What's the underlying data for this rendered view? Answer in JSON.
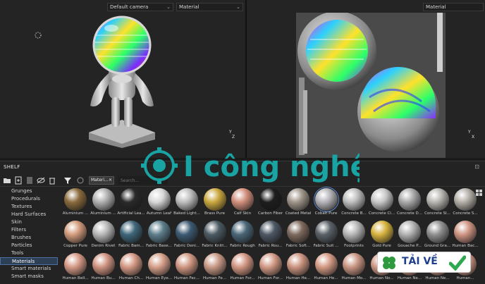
{
  "viewport3d": {
    "camera_dropdown": "Default camera",
    "channel_dropdown": "Material",
    "axis_y": "Y",
    "axis_z": "Z",
    "axis_x": "X"
  },
  "viewport2d": {
    "channel_dropdown": "Material",
    "axis_y": "Y",
    "axis_x": "X"
  },
  "shelf": {
    "title": "SHELF",
    "filter_chip": "Materi...",
    "search_placeholder": "Search...",
    "categories": [
      "Grunges",
      "Procedurals",
      "Textures",
      "Hard Surfaces",
      "Skin",
      "Filters",
      "Brushes",
      "Particles",
      "Tools",
      "Materials",
      "Smart materials",
      "Smart masks"
    ],
    "selected_category": "Materials",
    "materials": [
      {
        "label": "Aluminium ...",
        "color": "#8a6a3c"
      },
      {
        "label": "Aluminium ...",
        "color": "#b0b0b0"
      },
      {
        "label": "Artificial Lea...",
        "color": "#2a2a2a"
      },
      {
        "label": "Autumn Leaf",
        "color": "#d7d7d7"
      },
      {
        "label": "Baked Light...",
        "color": "#bdbdbd"
      },
      {
        "label": "Brass Pure",
        "color": "#caa73e"
      },
      {
        "label": "Calf Skin",
        "color": "#d28f7c"
      },
      {
        "label": "Carbon Fiber",
        "color": "#1d1d1d"
      },
      {
        "label": "Coated Metal",
        "color": "#9e9489"
      },
      {
        "label": "Cobalt Pure",
        "color": "#b3b3b8"
      },
      {
        "label": "Concrete B...",
        "color": "#bdbdbd"
      },
      {
        "label": "Concrete Cl...",
        "color": "#c7c7c7"
      },
      {
        "label": "Concrete D...",
        "color": "#a9a9a9"
      },
      {
        "label": "Concrete Sl...",
        "color": "#b7b5b0"
      },
      {
        "label": "Concrete S...",
        "color": "#b3aea7"
      },
      {
        "label": "Copper Pure",
        "color": "#d29b7c"
      },
      {
        "label": "Denim Rivet",
        "color": "#b7b7b7"
      },
      {
        "label": "Fabric Bam...",
        "color": "#3f6679"
      },
      {
        "label": "Fabric Base...",
        "color": "#5d7d8c"
      },
      {
        "label": "Fabric Deni...",
        "color": "#3c5a72"
      },
      {
        "label": "Fabric Knitt...",
        "color": "#4c5a63"
      },
      {
        "label": "Fabric Rough",
        "color": "#4a6677"
      },
      {
        "label": "Fabric Rou...",
        "color": "#4d5864"
      },
      {
        "label": "Fabric Soft...",
        "color": "#7e695d"
      },
      {
        "label": "Fabric Suit ...",
        "color": "#596067"
      },
      {
        "label": "Footprints",
        "color": "#b6b6b6"
      },
      {
        "label": "Gold Pure",
        "color": "#d6b23e"
      },
      {
        "label": "Gouache P...",
        "color": "#b1b1b1"
      },
      {
        "label": "Ground Gra...",
        "color": "#8f8f8f"
      },
      {
        "label": "Human Bac...",
        "color": "#cf9583"
      },
      {
        "label": "Human Bell...",
        "color": "#d69a86"
      },
      {
        "label": "Human Bu...",
        "color": "#cf9380"
      },
      {
        "label": "Human Ch...",
        "color": "#d49984"
      },
      {
        "label": "Human Eye...",
        "color": "#d6a08a"
      },
      {
        "label": "Human Fac...",
        "color": "#d19782"
      },
      {
        "label": "Human Fe...",
        "color": "#c89a86"
      },
      {
        "label": "Human For...",
        "color": "#d39783"
      },
      {
        "label": "Human For...",
        "color": "#d29a85"
      },
      {
        "label": "Human He...",
        "color": "#cc9480"
      },
      {
        "label": "Human He...",
        "color": "#d49a84"
      },
      {
        "label": "Human Mo...",
        "color": "#c99683"
      },
      {
        "label": "Human No...",
        "color": "#d19a86"
      },
      {
        "label": "Human Ne...",
        "color": "#d29883"
      },
      {
        "label": "Human Ne...",
        "color": "#cf9682"
      },
      {
        "label": "Human...",
        "color": "#d09885"
      }
    ],
    "selected_material_index": 9
  },
  "watermark": {
    "brand": "I công nghệ",
    "color": "#19a3a3"
  },
  "badge": {
    "text": "TẢI VỀ",
    "check_color": "#2fa84f",
    "clover_color": "#2e9a3e",
    "text_color": "#1d3f8e"
  }
}
